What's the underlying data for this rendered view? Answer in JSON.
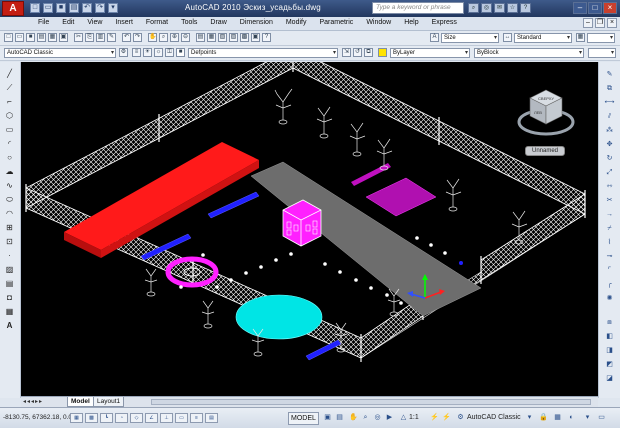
{
  "app": {
    "title": "AutoCAD 2010   Эскиз_усадьбы.dwg",
    "logo_letter": "A",
    "search_placeholder": "Type a keyword or phrase"
  },
  "menu": [
    "File",
    "Edit",
    "View",
    "Insert",
    "Format",
    "Tools",
    "Draw",
    "Dimension",
    "Modify",
    "Parametric",
    "Window",
    "Help",
    "Express"
  ],
  "toolbar": {
    "text_style": "Standard",
    "dim_style": "Standard",
    "dim_size_label": "Size",
    "workspace": "AutoCAD Classic",
    "layer": "Defpoints",
    "color": "ByLayer",
    "linetype": "ByBlock"
  },
  "viewcube": {
    "front": "ЛЕВ",
    "top": "СВЕРХУ",
    "ucs": "Unnamed"
  },
  "tabs": {
    "model": "Model",
    "layout1": "Layout1"
  },
  "status": {
    "coords": "-8130.75, 67362.18, 0.00",
    "model": "MODEL",
    "scale": "1:1",
    "workspace": "AutoCAD Classic"
  },
  "colors": {
    "red_pad": "#ff1a1a",
    "magenta": "#ff20ff",
    "blue_bench": "#2020ff",
    "cyan_pool": "#00e5e5",
    "path_gray": "#6d6d6d",
    "fence": "#ffffff"
  }
}
